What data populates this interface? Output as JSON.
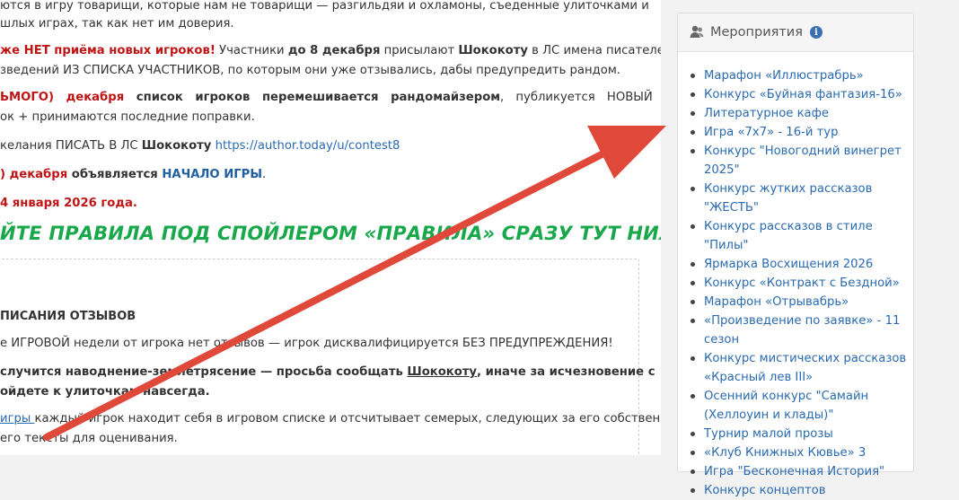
{
  "main": {
    "line1": "ются в игру товарищи, которые нам не товарищи — разгильдяи и охламоны, съеденные улиточками и",
    "line2": "шлых играх, так как нет им доверия.",
    "line3_a": "же НЕТ приёма новых игроков!",
    "line3_b": " Участники ",
    "line3_c": "до 8 декабря",
    "line3_d": " присылают ",
    "line3_e": "Шококоту",
    "line3_f": " в ЛС имена писателей",
    "line4": "зведений ИЗ СПИСКА УЧАСТНИКОВ, по которым они уже отзывались, дабы предупредить рандом.",
    "line5_a": "ЬМОГО) декабря",
    "line5_b": " список игроков перемешивается ",
    "line5_c": "рандомайзером",
    "line5_d": ", публикуется НОВЫЙ",
    "line6": "ок + принимаются последние поправки.",
    "line7_a": "келания ПИСАТЬ В ЛС ",
    "line7_b": "Шококоту",
    "line7_c": " https://author.today/u/contest8",
    "line8_a": ") декабря",
    "line8_b": " объявляется ",
    "line8_c": "НАЧАЛО ИГРЫ",
    "line8_d": ".",
    "line9": "4 января 2026 года.",
    "slogan": "ЙТЕ ПРАВИЛА ПОД СПОЙЛЕРОМ «ПРАВИЛА» СРАЗУ ТУТ НИЖЕ!!!",
    "spoiler_title": "ПИСАНИЯ ОТЗЫВОВ",
    "sp_line1": "е ИГРОВОЙ недели от игрока нет отзывов — игрок дисквалифицируется БЕЗ ПРЕДУПРЕЖДЕНИЯ!",
    "sp_line2_a": "случится наводнение-землетрясение — просьба сообщать ",
    "sp_line2_b": "Шококоту",
    "sp_line2_c": ", иначе за исчезновение с",
    "sp_line3": "ойдете к улиточкам навсегда.",
    "sp_line4_a": "игры ",
    "sp_line4_b": "каждый игрок находит себя в игровом списке и отсчитывает семерых, следующих за его собственной",
    "sp_line5": "его тексты для оценивания."
  },
  "sidebar": {
    "title": "Мероприятия",
    "info_glyph": "i",
    "items": [
      "Марафон «Иллюстрабрь»",
      "Конкурс «Буйная фантазия-16»",
      "Литературное кафе",
      "Игра «7х7» - 16-й тур",
      "Конкурс \"Новогодний винегрет 2025\"",
      "Конкурс жутких рассказов \"ЖЕСТЬ\"",
      "Конкурс рассказов в стиле \"Пилы\"",
      "Ярмарка Восхищения 2026",
      "Конкурс «Контракт с Бездной»",
      "Марафон «Отрывабрь»",
      "«Произведение по заявке» - 11 сезон",
      "Конкурс мистических рассказов «Красный лев III»",
      "Осенний конкурс \"Самайн (Хеллоуин и клады)\"",
      "Турнир малой прозы",
      "«Клуб Книжных Кювье» 3",
      "Игра \"Бесконечная История\"",
      "Конкурс концептов"
    ]
  },
  "colors": {
    "arrow": "#e0483a",
    "accent_red": "#c01515",
    "link_blue": "#2a6ab0",
    "slogan_green": "#18a84a"
  }
}
